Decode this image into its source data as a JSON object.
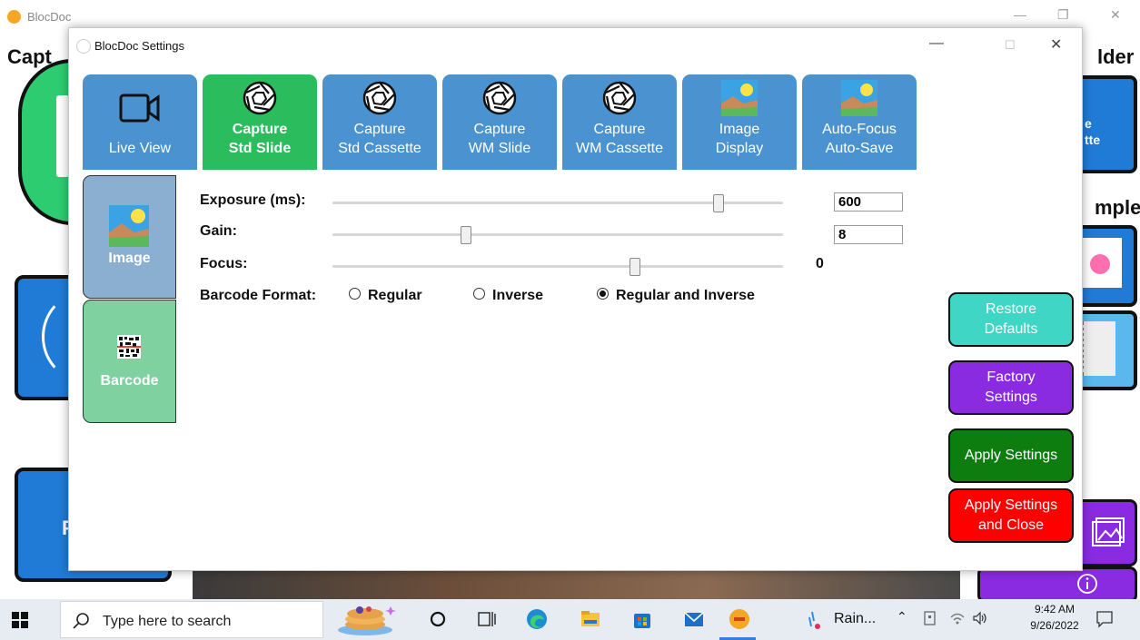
{
  "background_app": {
    "title": "BlocDoc",
    "heading_left": "Capt",
    "heading_right": "lder",
    "heading_right2": "mple",
    "blue_box_text": "e\ntte",
    "blue_box_letter": "F"
  },
  "settings_window": {
    "title": "BlocDoc Settings",
    "tabs": [
      {
        "line1": "",
        "line2": "Live View",
        "icon": "video-camera-icon",
        "active": false
      },
      {
        "line1": "Capture",
        "line2": "Std Slide",
        "icon": "camera-aperture-icon",
        "active": true
      },
      {
        "line1": "Capture",
        "line2": "Std Cassette",
        "icon": "camera-aperture-icon",
        "active": false
      },
      {
        "line1": "Capture",
        "line2": "WM Slide",
        "icon": "camera-aperture-icon",
        "active": false
      },
      {
        "line1": "Capture",
        "line2": "WM Cassette",
        "icon": "camera-aperture-icon",
        "active": false
      },
      {
        "line1": "Image",
        "line2": "Display",
        "icon": "landscape-image-icon",
        "active": false
      },
      {
        "line1": "Auto-Focus",
        "line2": "Auto-Save",
        "icon": "landscape-image-icon",
        "active": false
      }
    ],
    "side_tabs": {
      "image": "Image",
      "barcode": "Barcode"
    },
    "fields": {
      "exposure_label": "Exposure (ms):",
      "exposure_value": "600",
      "exposure_level": 0.855,
      "gain_label": "Gain:",
      "gain_value": "8",
      "gain_level": 0.295,
      "focus_label": "Focus:",
      "focus_value": "0",
      "focus_level": 0.67,
      "barcode_label": "Barcode Format:",
      "barcode_options": [
        "Regular",
        "Inverse",
        "Regular and Inverse"
      ],
      "barcode_selected": "Regular and Inverse"
    },
    "buttons": {
      "restore": "Restore Defaults",
      "factory": "Factory Settings",
      "apply": "Apply Settings",
      "apply_close": "Apply Settings and Close"
    },
    "colors": {
      "tab_blue": "#4a93d0",
      "tab_active": "#2bbd5d",
      "restore": "#3fd6c6",
      "factory": "#8a2be2",
      "apply": "#0e7d10",
      "apply_close": "#ff0000"
    }
  },
  "taskbar": {
    "search_placeholder": "Type here to search",
    "weather": "Rain...",
    "time": "9:42 AM",
    "date": "9/26/2022"
  }
}
